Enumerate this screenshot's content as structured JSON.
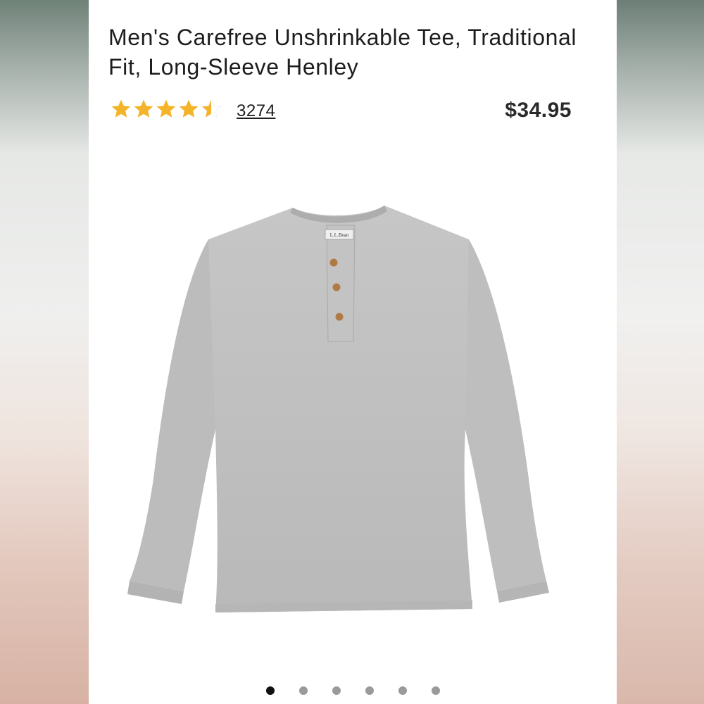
{
  "product": {
    "title": "Men's Carefree Unshrinkable Tee, Traditional Fit, Long-Sleeve Henley",
    "rating": 4.5,
    "rating_max": 5,
    "review_count": "3274",
    "price": "$34.95",
    "label_text": "L.L.Bean"
  },
  "colors": {
    "star": "#f4b42a",
    "star_empty": "#d9d9d9",
    "shirt": "#bdbdbd",
    "button": "#b07a45"
  },
  "carousel": {
    "count": 6,
    "active_index": 0
  }
}
